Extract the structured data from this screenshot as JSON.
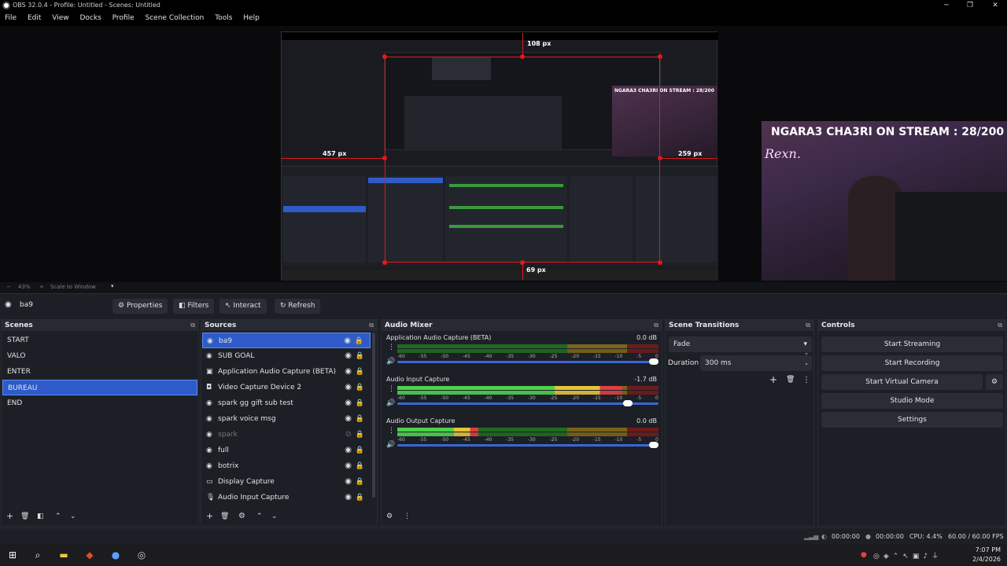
{
  "window": {
    "title": "OBS 32.0.4 - Profile: Untitled - Scenes: Untitled",
    "min_label": "─",
    "max_label": "❐",
    "close_label": "✕"
  },
  "menu": [
    "File",
    "Edit",
    "View",
    "Docks",
    "Profile",
    "Scene Collection",
    "Tools",
    "Help"
  ],
  "preview": {
    "measure_top": "108 px",
    "measure_left": "457 px",
    "measure_right": "259 px",
    "measure_bottom": "69 px",
    "overlay_text": "NGARA3 CHA3RI ON STREAM : 28/200",
    "overlay_brand": "Rexn.",
    "inner_overlay_text": "NGARA3 CHA3RI ON STREAM : 28/200"
  },
  "preview_bar": {
    "minus": "−",
    "zoom": "43%",
    "plus": "+",
    "mode": "Scale to Window",
    "caret": "▾"
  },
  "scene_toolbar": {
    "current_source": "ba9",
    "properties": "Properties",
    "filters": "Filters",
    "interact": "Interact",
    "refresh": "Refresh"
  },
  "scenes": {
    "title": "Scenes",
    "items": [
      "START",
      "VALO",
      "ENTER",
      "BUREAU",
      "END"
    ],
    "selected": "BUREAU"
  },
  "sources": {
    "title": "Sources",
    "items": [
      {
        "label": "ba9",
        "icon": "globe-icon",
        "visible": true,
        "selected": true
      },
      {
        "label": "SUB GOAL",
        "icon": "globe-icon",
        "visible": true
      },
      {
        "label": "Application Audio Capture (BETA)",
        "icon": "window-icon",
        "visible": true
      },
      {
        "label": "Video Capture Device 2",
        "icon": "camera-icon",
        "visible": true
      },
      {
        "label": "spark gg gift sub test",
        "icon": "globe-icon",
        "visible": true
      },
      {
        "label": "spark voice msg",
        "icon": "globe-icon",
        "visible": true
      },
      {
        "label": "spark",
        "icon": "globe-icon",
        "visible": false
      },
      {
        "label": "full",
        "icon": "globe-icon",
        "visible": true
      },
      {
        "label": "botrix",
        "icon": "globe-icon",
        "visible": true
      },
      {
        "label": "Display Capture",
        "icon": "monitor-icon",
        "visible": true
      },
      {
        "label": "Audio Input Capture",
        "icon": "mic-icon",
        "visible": true
      }
    ]
  },
  "mixer": {
    "title": "Audio Mixer",
    "scale": [
      "-60",
      "-55",
      "-50",
      "-45",
      "-40",
      "-35",
      "-30",
      "-25",
      "-20",
      "-15",
      "-10",
      "-5",
      "0"
    ],
    "channels": [
      {
        "name": "Application Audio Capture (BETA)",
        "db": "0.0 dB",
        "level": 0.0,
        "volume": 1.0
      },
      {
        "name": "Audio Input Capture",
        "db": "-1.7 dB",
        "level": 0.86,
        "volume": 0.9
      },
      {
        "name": "Audio Output Capture",
        "db": "0.0 dB",
        "level": 0.31,
        "volume": 1.0
      }
    ]
  },
  "transitions": {
    "title": "Scene Transitions",
    "selected": "Fade",
    "duration_label": "Duration",
    "duration_value": "300 ms"
  },
  "controls": {
    "title": "Controls",
    "start_streaming": "Start Streaming",
    "start_recording": "Start Recording",
    "start_virtual_camera": "Start Virtual Camera",
    "studio_mode": "Studio Mode",
    "settings": "Settings"
  },
  "status": {
    "stream_time": "00:00:00",
    "rec_time": "00:00:00",
    "cpu": "CPU: 4.4%",
    "fps": "60.00 / 60.00 FPS"
  },
  "taskbar": {
    "time": "7:07 PM",
    "date": "2/4/2026"
  },
  "colors": {
    "accent": "#2e5bc9",
    "selection_border": "#e0191a",
    "meter_green": "#4cd14c",
    "meter_yellow": "#e3c33c",
    "meter_red": "#e04040"
  }
}
